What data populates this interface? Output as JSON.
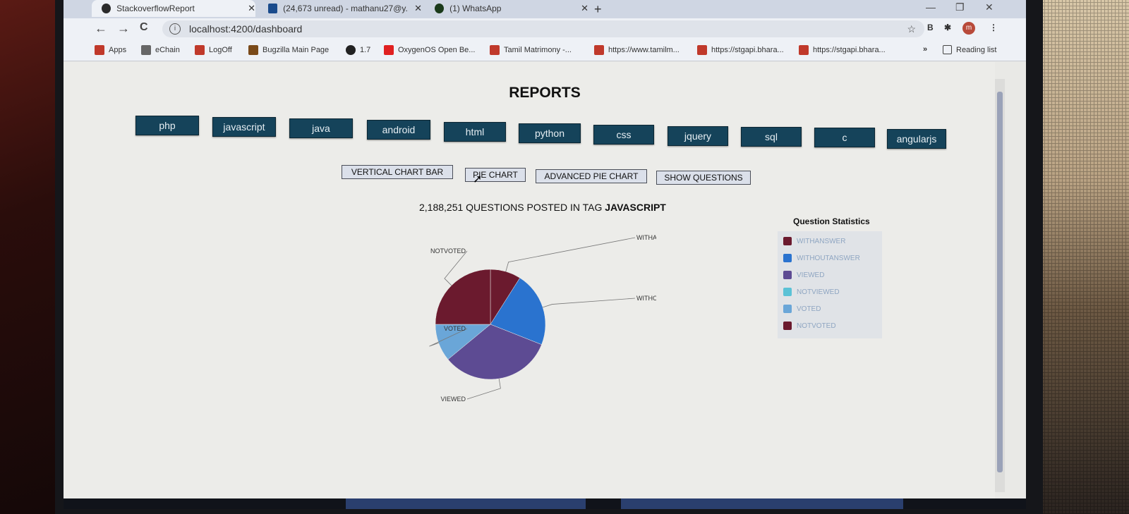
{
  "browser": {
    "tabs": [
      {
        "label": "StackoverflowReport",
        "icon": "angular-icon",
        "color": "#2b2b2b",
        "active": true
      },
      {
        "label": "(24,673 unread) - mathanu27@y...",
        "icon": "mail-icon",
        "color": "#1a4b8c",
        "active": false
      },
      {
        "label": "(1) WhatsApp",
        "icon": "whatsapp-icon",
        "color": "#1a3a1a",
        "active": false
      }
    ],
    "close_glyph": "✕",
    "new_tab_glyph": "+",
    "window_controls": {
      "minimize": "—",
      "restore": "❐",
      "close": "✕"
    },
    "nav": {
      "back": "←",
      "forward": "→",
      "reload": "C"
    },
    "url": "localhost:4200/dashboard",
    "info_glyph": "i",
    "star_glyph": "☆",
    "extensions": {
      "ext1": "B",
      "ext2": "✱",
      "profile": "m",
      "menu": "⋮"
    },
    "bookmarks": [
      {
        "label": "Apps",
        "color": "#c0392b"
      },
      {
        "label": "eChain",
        "color": "#666666"
      },
      {
        "label": "LogOff",
        "color": "#c0392b"
      },
      {
        "label": "Bugzilla Main Page",
        "color": "#7a4a1a"
      },
      {
        "label": "1.7",
        "color": "#222222"
      },
      {
        "label": "OxygenOS Open Be...",
        "color": "#e02020"
      },
      {
        "label": "Tamil Matrimony -...",
        "color": "#c0392b"
      },
      {
        "label": "https://www.tamilm...",
        "color": "#c0392b"
      },
      {
        "label": "https://stgapi.bhara...",
        "color": "#c0392b"
      },
      {
        "label": "https://stgapi.bhara...",
        "color": "#c0392b"
      }
    ],
    "more_bookmarks": "»",
    "reading_list": "Reading list"
  },
  "page": {
    "title": "REPORTS",
    "tags": [
      "php",
      "javascript",
      "java",
      "android",
      "html",
      "python",
      "css",
      "jquery",
      "sql",
      "c",
      "angularjs"
    ],
    "chart_buttons": [
      "VERTICAL CHART BAR",
      "PIE CHART",
      "ADVANCED PIE CHART",
      "SHOW QUESTIONS"
    ],
    "headline_prefix": "2,188,251 QUESTIONS POSTED IN TAG",
    "headline_tag": "JAVASCRIPT",
    "legend_title": "Question Statistics"
  },
  "chart_data": {
    "type": "pie",
    "title": "",
    "labels": [
      "WITHANSWER",
      "WITHOUTANSWER",
      "VIEWED",
      "NOTVIEWED",
      "VOTED",
      "NOTVOTED"
    ],
    "values": [
      9,
      22,
      33,
      0,
      11,
      25
    ],
    "value_unit": "percent (estimated)",
    "colors": [
      "#6b1a2e",
      "#2a73cf",
      "#5d4b93",
      "#5bc2d6",
      "#6aa6d8",
      "#6b1a2e"
    ],
    "slice_labels": [
      "WITHANSWER",
      "WITHOUTANS...",
      "VIEWED",
      "",
      "VOTED",
      "NOTVOTED"
    ],
    "legend_position": "right"
  }
}
